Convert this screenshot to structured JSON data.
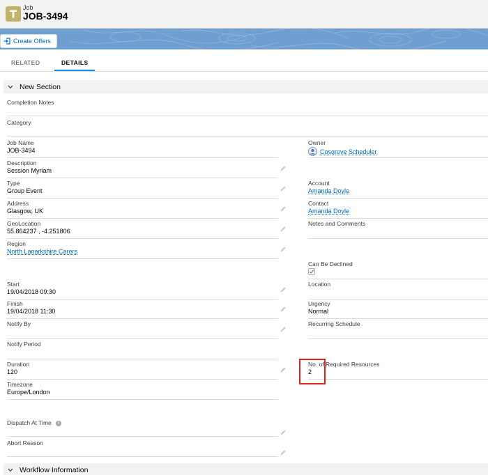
{
  "header": {
    "object_type": "Job",
    "title": "JOB-3494",
    "create_button": "Create Offers"
  },
  "tabs": [
    {
      "label": "RELATED"
    },
    {
      "label": "DETAILS",
      "active": true
    }
  ],
  "sections": {
    "new": "New Section",
    "workflow": "Workflow Information"
  },
  "fields": {
    "completion_notes": {
      "label": "Completion Notes",
      "value": ""
    },
    "category": {
      "label": "Category",
      "value": ""
    },
    "job_name": {
      "label": "Job Name",
      "value": "JOB-3494"
    },
    "description": {
      "label": "Description",
      "value": "Session Myriam"
    },
    "type": {
      "label": "Type",
      "value": "Group Event"
    },
    "address": {
      "label": "Address",
      "value": "Glasgow, UK"
    },
    "geolocation": {
      "label": "GeoLocation",
      "value": "55.864237 , -4.251806"
    },
    "region": {
      "label": "Region",
      "value": "North Lanarkshire Carers"
    },
    "start": {
      "label": "Start",
      "value": "19/04/2018 09:30"
    },
    "finish": {
      "label": "Finish",
      "value": "19/04/2018 11:30"
    },
    "notify_by": {
      "label": "Notify By",
      "value": ""
    },
    "notify_period": {
      "label": "Notify Period",
      "value": ""
    },
    "duration": {
      "label": "Duration",
      "value": "120"
    },
    "timezone": {
      "label": "Timezone",
      "value": "Europe/London"
    },
    "dispatch_at_time": {
      "label": "Dispatch At Time",
      "value": ""
    },
    "abort_reason": {
      "label": "Abort Reason",
      "value": ""
    },
    "owner": {
      "label": "Owner",
      "value": "Cosgrove Scheduler"
    },
    "account": {
      "label": "Account",
      "value": "Amanda Doyle"
    },
    "contact": {
      "label": "Contact",
      "value": "Amanda Doyle"
    },
    "notes_comments": {
      "label": "Notes and Comments",
      "value": ""
    },
    "can_be_declined": {
      "label": "Can Be Declined",
      "checked": true
    },
    "location": {
      "label": "Location",
      "value": ""
    },
    "urgency": {
      "label": "Urgency",
      "value": "Normal"
    },
    "recurring_schedule": {
      "label": "Recurring Schedule",
      "value": ""
    },
    "required_resources": {
      "label": "No. of Required Resources",
      "value": "2"
    }
  },
  "colors": {
    "accent": "#0070d2",
    "banner": "#6f9ed0",
    "object_icon": "#c1b46a",
    "highlight": "#e0201b"
  },
  "icons": [
    "job-object-icon",
    "create-offers-icon",
    "chevron-down-icon",
    "pencil-icon",
    "info-icon",
    "checkmark-icon",
    "user-avatar-icon"
  ]
}
